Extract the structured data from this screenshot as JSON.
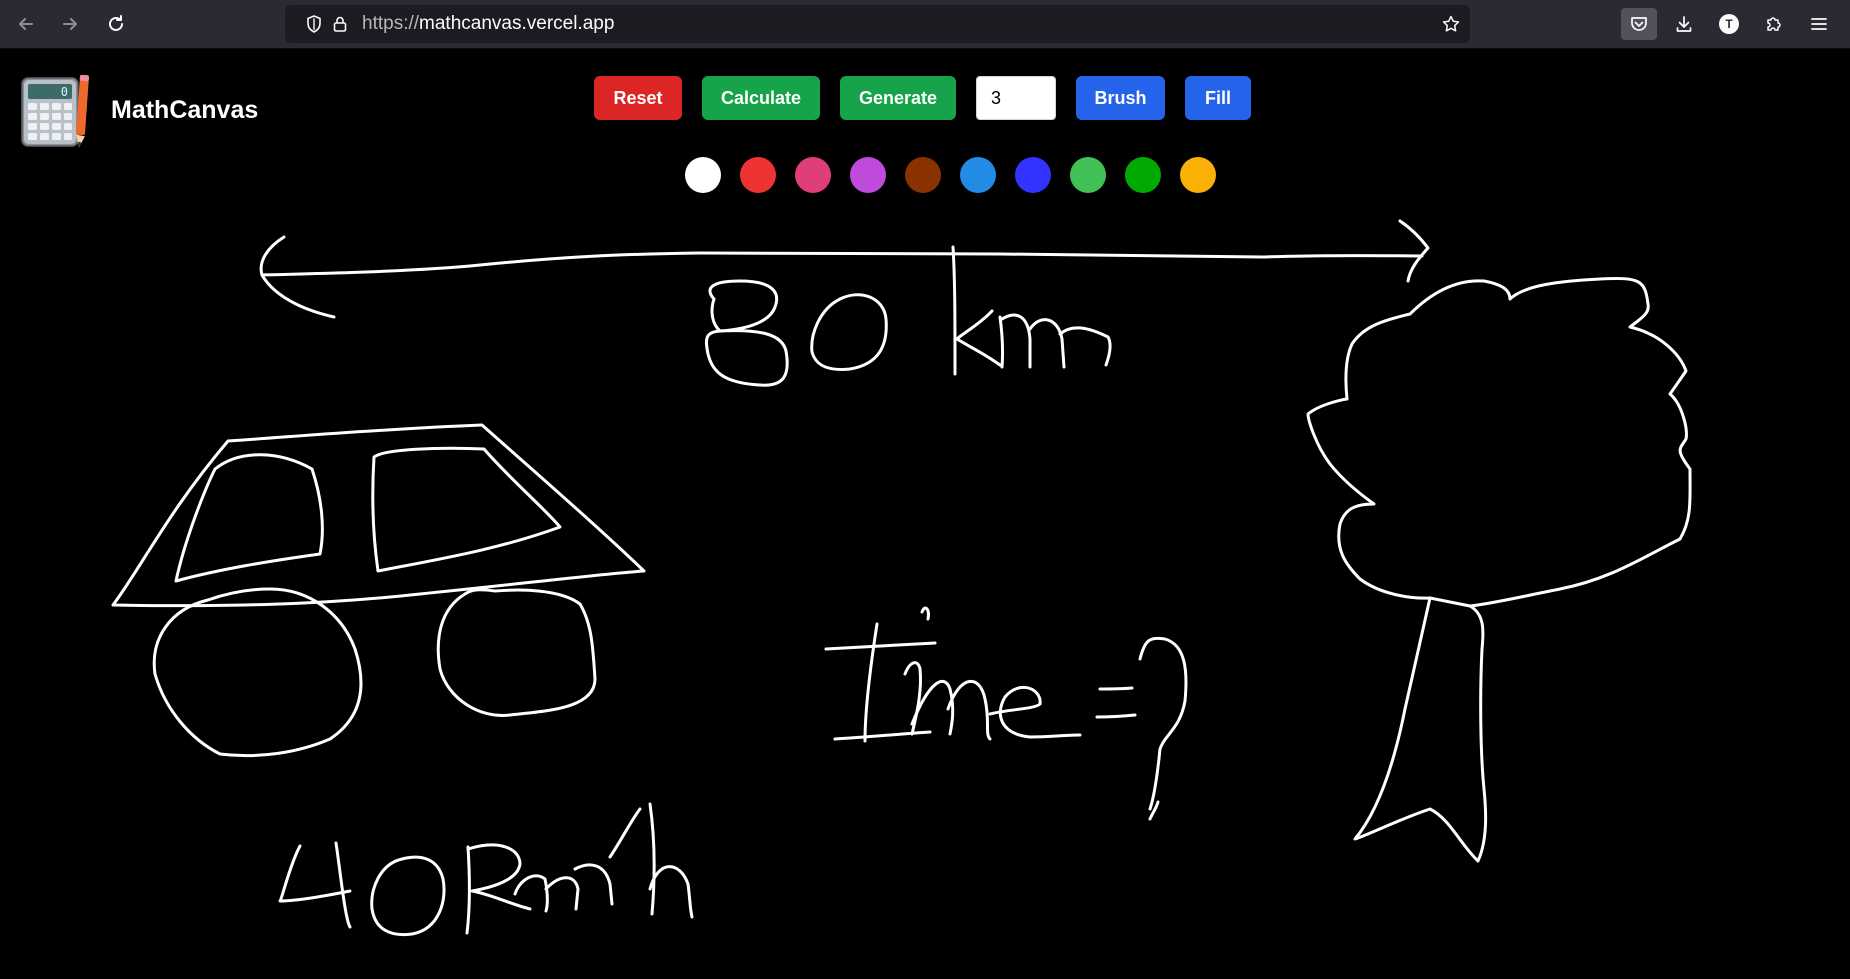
{
  "browser": {
    "url_scheme": "https://",
    "url_host": "mathcanvas.vercel.app",
    "account_initial": "T"
  },
  "app": {
    "title": "MathCanvas",
    "logo_display_digit": "0",
    "buttons": {
      "reset": "Reset",
      "calculate": "Calculate",
      "generate": "Generate",
      "brush": "Brush",
      "fill": "Fill"
    },
    "brush_size": "3",
    "colors": [
      "#000000",
      "#ffffff",
      "#ee3333",
      "#e03e7a",
      "#be4bdb",
      "#893200",
      "#228be6",
      "#3333ff",
      "#40c057",
      "#00aa00",
      "#fab005"
    ],
    "button_colors": {
      "reset": "#dc2626",
      "calculate": "#16a34a",
      "generate": "#16a34a",
      "brush": "#2563eb",
      "fill": "#2563eb"
    },
    "canvas_background": "#000000",
    "stroke_color": "#ffffff"
  },
  "canvas": {
    "handwritten_distance": "80 km",
    "handwritten_speed": "40km/h",
    "handwritten_question": "time = ?",
    "drawings": [
      "car",
      "tree",
      "double-headed arrow"
    ]
  }
}
